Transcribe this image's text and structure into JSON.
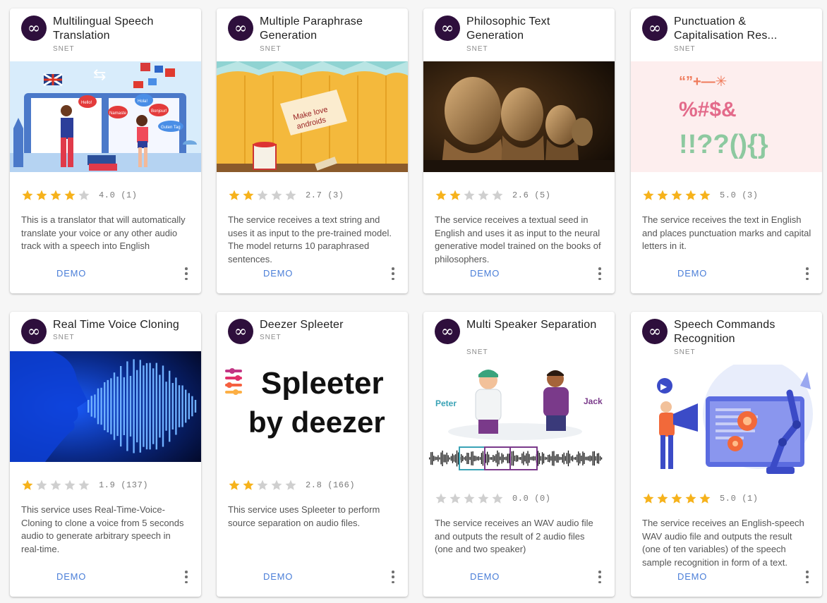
{
  "colors": {
    "star_filled": "#f6b21b",
    "star_empty": "#cfcfcf",
    "demo": "#4a7ed8",
    "avatar": "#2e0f3c"
  },
  "cards": [
    {
      "title": "Multilingual Speech Translation",
      "org": "SNET",
      "image": "translation-illustration",
      "rating": 4,
      "rating_text": "4.0 (1)",
      "description": "This is a translator that will automatically translate your voice or any other audio track with a speech into English",
      "demo_label": "DEMO",
      "image_text": [
        "Hello!",
        "Hola!",
        "Bonjour!",
        "Namaste",
        "Guten Tag"
      ]
    },
    {
      "title": "Multiple Paraphrase Generation",
      "org": "SNET",
      "image": "paint-fence-illustration",
      "image_text": [
        "Make love",
        "androids"
      ],
      "rating": 2,
      "rating_text": "2.7 (3)",
      "description": "The service receives a text string and uses it as input to the pre-trained model. The model returns 10 paraphrased sentences.",
      "demo_label": "DEMO"
    },
    {
      "title": "Philosophic Text Generation",
      "org": "SNET",
      "image": "philosopher-busts-photo",
      "rating": 2,
      "rating_text": "2.6 (5)",
      "description": "The service receives a textual seed in English and uses it as input to the neural generative model trained on the books of philosophers.",
      "demo_label": "DEMO"
    },
    {
      "title": "Punctuation & Capitalisation Res...",
      "org": "SNET",
      "image": "punctuation-marks-illustration",
      "image_text": [
        "“”+—✳",
        "%#$&",
        "!!??(){}"
      ],
      "rating": 5,
      "rating_text": "5.0 (3)",
      "description": "The service receives the text in English and places punctuation marks and capital letters in it.",
      "demo_label": "DEMO"
    },
    {
      "title": "Real Time Voice Cloning",
      "org": "SNET",
      "image": "voice-wave-face-illustration",
      "rating": 1,
      "rating_text": "1.9 (137)",
      "description": "This service uses Real-Time-Voice-Cloning to clone a voice from 5 seconds audio to generate arbitrary speech in real-time.",
      "demo_label": "DEMO"
    },
    {
      "title": "Deezer Spleeter",
      "org": "SNET",
      "image": "spleeter-logo",
      "image_text": [
        "Spleeter",
        "by deezer"
      ],
      "rating": 2,
      "rating_text": "2.8 (166)",
      "description": "This service uses Spleeter to perform source separation on audio files.",
      "demo_label": "DEMO"
    },
    {
      "title": "Multi Speaker Separation",
      "org": "SNET",
      "image": "two-speakers-waveform-illustration",
      "image_text": [
        "Peter",
        "Jack"
      ],
      "rating": 0,
      "rating_text": "0.0 (0)",
      "description": "The service receives an WAV audio file and outputs the result of 2 audio files (one and two speaker)",
      "demo_label": "DEMO"
    },
    {
      "title": "Speech Commands Recognition",
      "org": "SNET",
      "image": "robot-arm-megaphone-illustration",
      "rating": 5,
      "rating_text": "5.0 (1)",
      "description": "The service receives an English-speech WAV audio file and outputs the result (one of ten variables) of the speech sample recognition in form of a text.",
      "demo_label": "DEMO"
    }
  ]
}
